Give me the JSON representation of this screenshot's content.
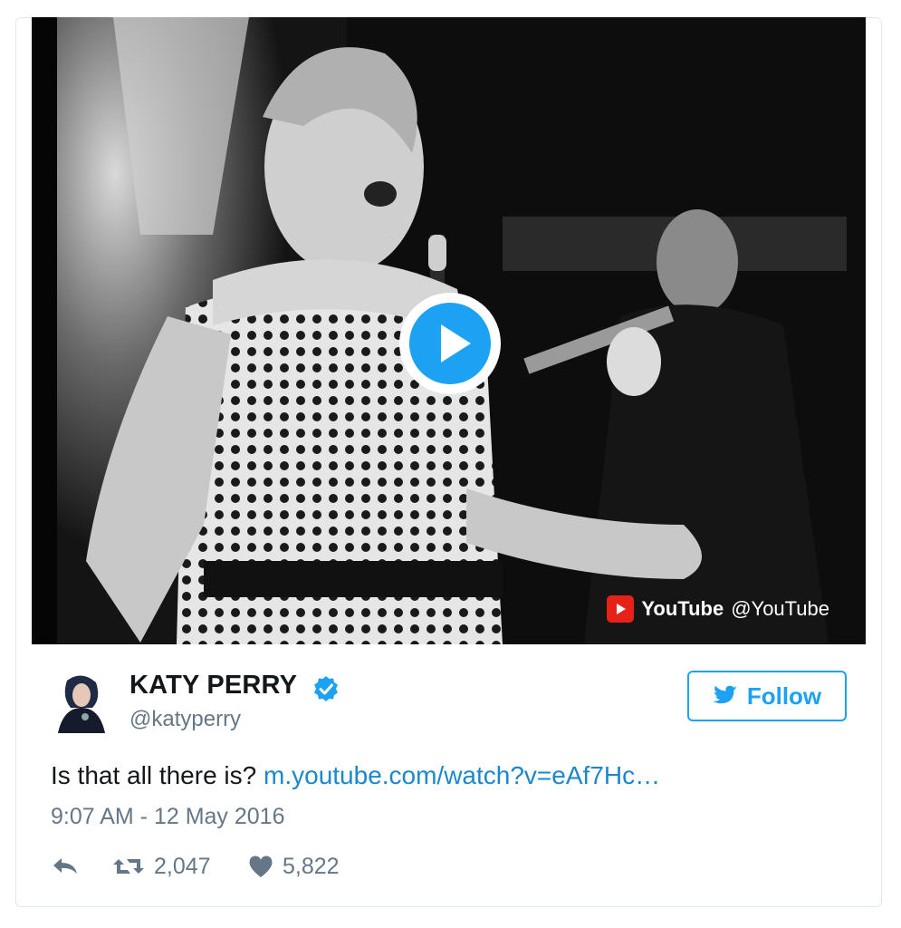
{
  "media": {
    "attribution_brand": "YouTube",
    "attribution_handle": "@YouTube",
    "play_icon": "play-icon",
    "youtube_icon": "youtube-logo-icon"
  },
  "user": {
    "display_name": "KATY PERRY",
    "screen_name": "@katyperry",
    "verified": true,
    "verified_icon": "verified-badge-icon"
  },
  "follow": {
    "label": "Follow",
    "icon": "twitter-bird-icon"
  },
  "tweet": {
    "text": "Is that all there is?",
    "link": "m.youtube.com/watch?v=eAf7Hc…",
    "timestamp": "9:07 AM - 12 May 2016"
  },
  "stats": {
    "reply_icon": "reply-icon",
    "retweet_icon": "retweet-icon",
    "retweets": "2,047",
    "like_icon": "heart-icon",
    "likes": "5,822"
  },
  "colors": {
    "accent": "#1da1f2",
    "link": "#1b87cc",
    "muted": "#657786",
    "youtube_red": "#e62117"
  }
}
